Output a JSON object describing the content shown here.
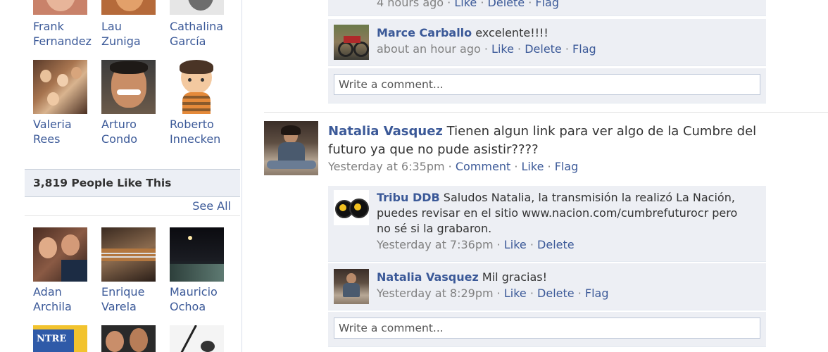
{
  "friends": [
    {
      "first": "Frank",
      "last": "Fernandez"
    },
    {
      "first": "Lau",
      "last": "Zuniga"
    },
    {
      "first": "Cathalina",
      "last": "García"
    },
    {
      "first": "Valeria",
      "last": "Rees"
    },
    {
      "first": "Arturo",
      "last": "Condo"
    },
    {
      "first": "Roberto",
      "last": "Innecken"
    }
  ],
  "likes": {
    "title": "3,819 People Like This",
    "see_all": "See All",
    "people": [
      {
        "first": "Adan",
        "last": "Archila"
      },
      {
        "first": "Enrique",
        "last": "Varela"
      },
      {
        "first": "Mauricio",
        "last": "Ochoa"
      }
    ],
    "partial_logo_text": "NTRE"
  },
  "stream": {
    "top_comment_meta": {
      "time": "4 hours ago",
      "like": "Like",
      "delete": "Delete",
      "flag": "Flag"
    },
    "comment_marce": {
      "author": "Marce Carballo",
      "text": "excelente!!!!",
      "time": "about an hour ago",
      "like": "Like",
      "delete": "Delete",
      "flag": "Flag"
    },
    "write_placeholder_1": "Write a comment...",
    "post": {
      "author": "Natalia Vasquez",
      "text": "Tienen algun link para ver algo de la Cumbre del futuro ya que no pude asistir????",
      "time": "Yesterday at 6:35pm",
      "comment": "Comment",
      "like": "Like",
      "flag": "Flag"
    },
    "comment_tribu": {
      "author": "Tribu DDB",
      "text": "Saludos Natalia, la transmisión la realizó La Nación, puedes revisar en el sitio www.nacion.com/cumbrefuturocr pero no sé si la grabaron.",
      "time": "Yesterday at 7:36pm",
      "like": "Like",
      "delete": "Delete"
    },
    "comment_natalia": {
      "author": "Natalia Vasquez",
      "text": "Mil gracias!",
      "time": "Yesterday at 8:29pm",
      "like": "Like",
      "delete": "Delete",
      "flag": "Flag"
    },
    "write_placeholder_2": "Write a comment..."
  },
  "colors": {
    "link": "#3b5998",
    "comment_bg": "#edeff4",
    "meta": "#808080"
  }
}
